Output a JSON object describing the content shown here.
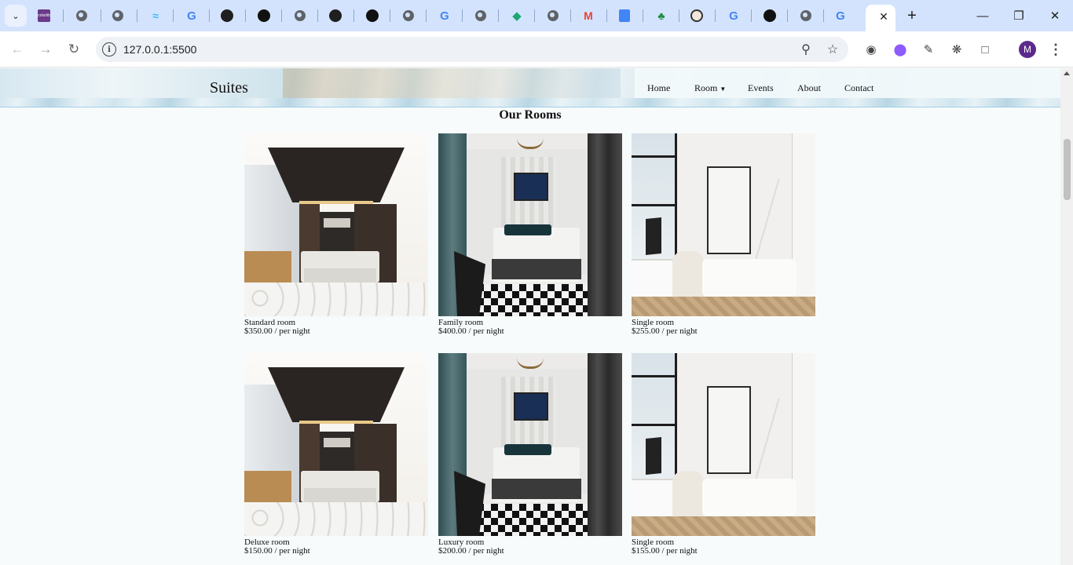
{
  "browser": {
    "url": "127.0.0.1:5500",
    "profile_initial": "M",
    "tabs": [
      {
        "icon": "chevron-down-icon"
      },
      {
        "icon": "colorlib-icon",
        "label": "colorlib"
      },
      {
        "icon": "globe-icon"
      },
      {
        "icon": "globe-icon"
      },
      {
        "icon": "tailwind-icon"
      },
      {
        "icon": "google-icon"
      },
      {
        "icon": "github-icon"
      },
      {
        "icon": "amazon-icon"
      },
      {
        "icon": "globe-icon"
      },
      {
        "icon": "github-icon"
      },
      {
        "icon": "arc-icon"
      },
      {
        "icon": "globe-icon"
      },
      {
        "icon": "google-icon"
      },
      {
        "icon": "globe-icon"
      },
      {
        "icon": "kite-icon"
      },
      {
        "icon": "globe-icon"
      },
      {
        "icon": "gmail-icon"
      },
      {
        "icon": "docs-icon"
      },
      {
        "icon": "tree-icon"
      },
      {
        "icon": "avatar-icon"
      },
      {
        "icon": "google-icon"
      },
      {
        "icon": "openai-icon"
      },
      {
        "icon": "globe-icon"
      },
      {
        "icon": "google-icon"
      },
      {
        "icon": "google-icon",
        "active": true
      }
    ]
  },
  "site": {
    "logo": "Suites",
    "nav": {
      "home": "Home",
      "room": "Room",
      "events": "Events",
      "about": "About",
      "contact": "Contact"
    },
    "section_title": "Our Rooms",
    "rooms": [
      {
        "name": "Standard room",
        "price": "$350.00 / per night",
        "image": "standard"
      },
      {
        "name": "Family room",
        "price": "$400.00 / per night",
        "image": "family"
      },
      {
        "name": "Single room",
        "price": "$255.00 / per night",
        "image": "single"
      },
      {
        "name": "Deluxe room",
        "price": "$150.00 / per night",
        "image": "standard"
      },
      {
        "name": "Luxury room",
        "price": "$200.00 / per night",
        "image": "family"
      },
      {
        "name": "Single room",
        "price": "$155.00 / per night",
        "image": "single"
      }
    ]
  }
}
